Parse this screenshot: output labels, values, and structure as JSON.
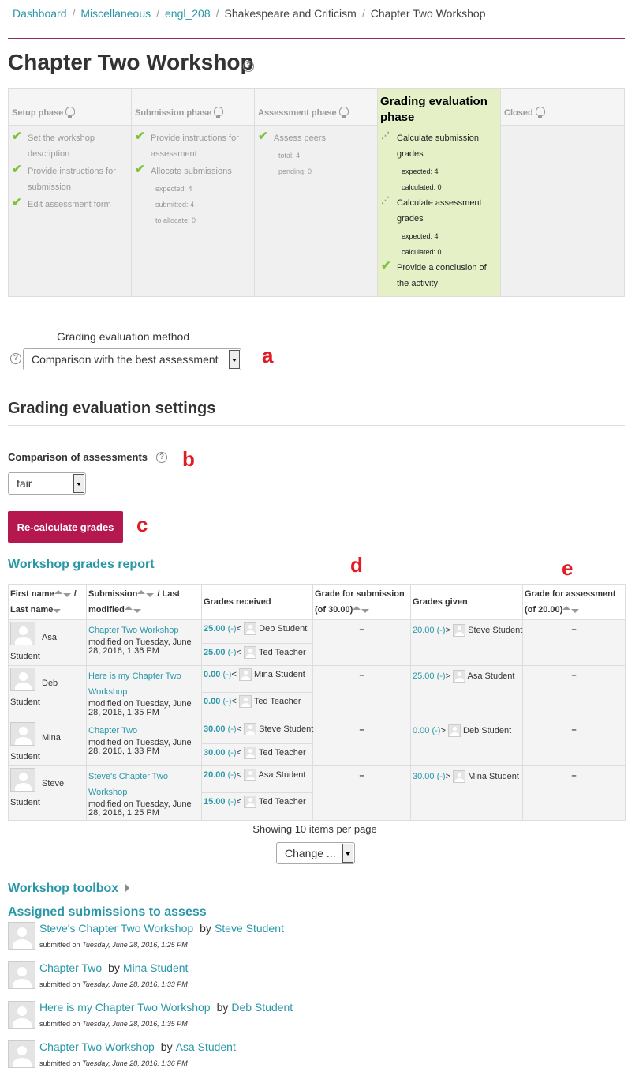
{
  "breadcrumb": {
    "items": [
      "Dashboard",
      "Miscellaneous",
      "engl_208",
      "Shakespeare and Criticism",
      "Chapter Two Workshop"
    ],
    "separator": "/"
  },
  "page": {
    "title": "Chapter Two Workshop"
  },
  "phases": [
    {
      "name": "Setup phase",
      "tasks": [
        {
          "label": "Set the workshop description",
          "status": "done",
          "details": []
        },
        {
          "label": "Provide instructions for submission",
          "status": "done",
          "details": []
        },
        {
          "label": "Edit assessment form",
          "status": "done",
          "details": []
        }
      ]
    },
    {
      "name": "Submission phase",
      "tasks": [
        {
          "label": "Provide instructions for assessment",
          "status": "done",
          "details": []
        },
        {
          "label": "Allocate submissions",
          "status": "done",
          "details": [
            "expected: 4",
            "submitted: 4",
            "to allocate: 0"
          ]
        }
      ]
    },
    {
      "name": "Assessment phase",
      "tasks": [
        {
          "label": "Assess peers",
          "status": "done",
          "details": [
            "total: 4",
            "pending: 0"
          ]
        }
      ]
    },
    {
      "name": "Grading evaluation phase",
      "active": true,
      "tasks": [
        {
          "label": "Calculate submission grades",
          "status": "pending",
          "details": [
            "expected: 4",
            "calculated: 0"
          ]
        },
        {
          "label": "Calculate assessment grades",
          "status": "pending",
          "details": [
            "expected: 4",
            "calculated: 0"
          ]
        },
        {
          "label": "Provide a conclusion of the activity",
          "status": "done",
          "details": []
        }
      ]
    },
    {
      "name": "Closed",
      "tasks": []
    }
  ],
  "grading_method": {
    "label": "Grading evaluation method",
    "selected": "Comparison with the best assessment",
    "marker": "a"
  },
  "settings": {
    "title": "Grading evaluation settings",
    "comparison_label": "Comparison of assessments",
    "comparison_selected": "fair",
    "marker": "b"
  },
  "recalc": {
    "label": "Re-calculate grades",
    "marker": "c"
  },
  "report": {
    "title": "Workshop grades report",
    "markers": {
      "d": "d",
      "e": "e"
    },
    "headers": {
      "first_name": "First name",
      "last_name": "Last name",
      "submission": "Submission",
      "last_modified": "Last modified",
      "grades_received": "Grades received",
      "grade_for_submission": "Grade for submission",
      "grade_for_submission_max": "(of 30.00)",
      "grades_given": "Grades given",
      "grade_for_assessment": "Grade for assessment",
      "grade_for_assessment_max": "(of 20.00)"
    },
    "rows": [
      {
        "first": "Asa",
        "last": "Student",
        "submission": "Chapter Two Workshop",
        "modified": "modified on Tuesday, June 28, 2016, 1:36 PM",
        "received": [
          {
            "grade": "25.00",
            "flag": "(-)",
            "dir": "<",
            "reviewer": "Deb Student"
          },
          {
            "grade": "25.00",
            "flag": "(-)",
            "dir": "<",
            "reviewer": "Ted Teacher"
          }
        ],
        "sub_grade": "–",
        "given": {
          "grade": "20.00",
          "flag": "(-)",
          "dir": ">",
          "reviewee": "Steve Student"
        },
        "assess_grade": "–"
      },
      {
        "first": "Deb",
        "last": "Student",
        "submission": "Here is my Chapter Two Workshop",
        "modified": "modified on Tuesday, June 28, 2016, 1:35 PM",
        "received": [
          {
            "grade": "0.00",
            "flag": "(-)",
            "dir": "<",
            "reviewer": "Mina Student"
          },
          {
            "grade": "0.00",
            "flag": "(-)",
            "dir": "<",
            "reviewer": "Ted Teacher"
          }
        ],
        "sub_grade": "–",
        "given": {
          "grade": "25.00",
          "flag": "(-)",
          "dir": ">",
          "reviewee": "Asa Student"
        },
        "assess_grade": "–"
      },
      {
        "first": "Mina",
        "last": "Student",
        "submission": "Chapter Two",
        "modified": "modified on Tuesday, June 28, 2016, 1:33 PM",
        "received": [
          {
            "grade": "30.00",
            "flag": "(-)",
            "dir": "<",
            "reviewer": "Steve Student"
          },
          {
            "grade": "30.00",
            "flag": "(-)",
            "dir": "<",
            "reviewer": "Ted Teacher"
          }
        ],
        "sub_grade": "–",
        "given": {
          "grade": "0.00",
          "flag": "(-)",
          "dir": ">",
          "reviewee": "Deb Student"
        },
        "assess_grade": "–"
      },
      {
        "first": "Steve",
        "last": "Student",
        "submission": "Steve's Chapter Two Workshop",
        "modified": "modified on Tuesday, June 28, 2016, 1:25 PM",
        "received": [
          {
            "grade": "20.00",
            "flag": "(-)",
            "dir": "<",
            "reviewer": "Asa Student"
          },
          {
            "grade": "15.00",
            "flag": "(-)",
            "dir": "<",
            "reviewer": "Ted Teacher"
          }
        ],
        "sub_grade": "–",
        "given": {
          "grade": "30.00",
          "flag": "(-)",
          "dir": ">",
          "reviewee": "Mina Student"
        },
        "assess_grade": "–"
      }
    ],
    "per_page_text": "Showing 10 items per page",
    "change_label": "Change ..."
  },
  "toolbox": {
    "label": "Workshop toolbox"
  },
  "assigned": {
    "title": "Assigned submissions to assess",
    "by": "by",
    "submitted_on": "submitted on",
    "items": [
      {
        "title": "Steve's Chapter Two Workshop",
        "author": "Steve Student",
        "date": "Tuesday, June 28, 2016, 1:25 PM"
      },
      {
        "title": "Chapter Two",
        "author": "Mina Student",
        "date": "Tuesday, June 28, 2016, 1:33 PM"
      },
      {
        "title": "Here is my Chapter Two Workshop",
        "author": "Deb Student",
        "date": "Tuesday, June 28, 2016, 1:35 PM"
      },
      {
        "title": "Chapter Two Workshop",
        "author": "Asa Student",
        "date": "Tuesday, June 28, 2016, 1:36 PM"
      }
    ]
  },
  "colors": {
    "link": "#2a97a8",
    "accent_rule": "#8c2d6a",
    "button": "#b5174f",
    "active_phase": "#e5f0c7",
    "check": "#7cc33a",
    "annotation": "#e01b24"
  },
  "icons": [
    "help-icon",
    "lightbulb-icon",
    "check-icon",
    "pending-icon",
    "sort-arrows-icon",
    "user-avatar-icon",
    "expand-triangle-icon",
    "dropdown-arrow-icon"
  ]
}
